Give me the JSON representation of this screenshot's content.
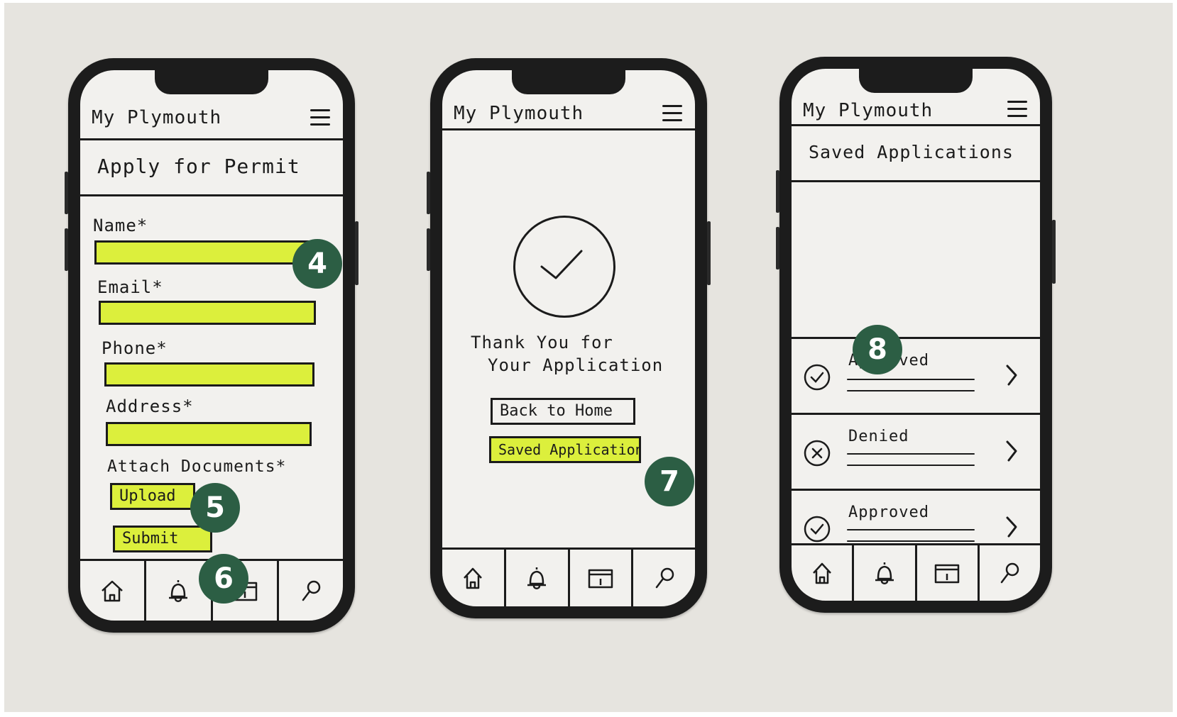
{
  "badges": {
    "b4": "4",
    "b5": "5",
    "b6": "6",
    "b7": "7",
    "b8": "8"
  },
  "phones": {
    "permit": {
      "app_title": "My Plymouth",
      "page_title": "Apply for Permit",
      "fields": {
        "name": "Name*",
        "email": "Email*",
        "phone": "Phone*",
        "address": "Address*",
        "attach": "Attach Documents*"
      },
      "upload_label": "Upload",
      "submit_label": "Submit"
    },
    "confirmation": {
      "app_title": "My Plymouth",
      "thanks_line1": "Thank You for",
      "thanks_line2": "Your Application",
      "back_label": "Back to Home",
      "saved_label": "Saved Application"
    },
    "saved": {
      "app_title": "My Plymouth",
      "page_title": "Saved Applications",
      "rows": [
        {
          "status": "Approved",
          "icon": "check-circle-icon"
        },
        {
          "status": "Denied",
          "icon": "x-circle-icon"
        },
        {
          "status": "Approved",
          "icon": "check-circle-icon"
        }
      ]
    }
  },
  "nav_icons": [
    "home-icon",
    "bell-icon",
    "calendar-icon",
    "search-icon"
  ],
  "colors": {
    "highlight": "#dcef3c",
    "badge": "#2c5e44",
    "ink": "#1b1b1b",
    "paper": "#e6e4df"
  }
}
